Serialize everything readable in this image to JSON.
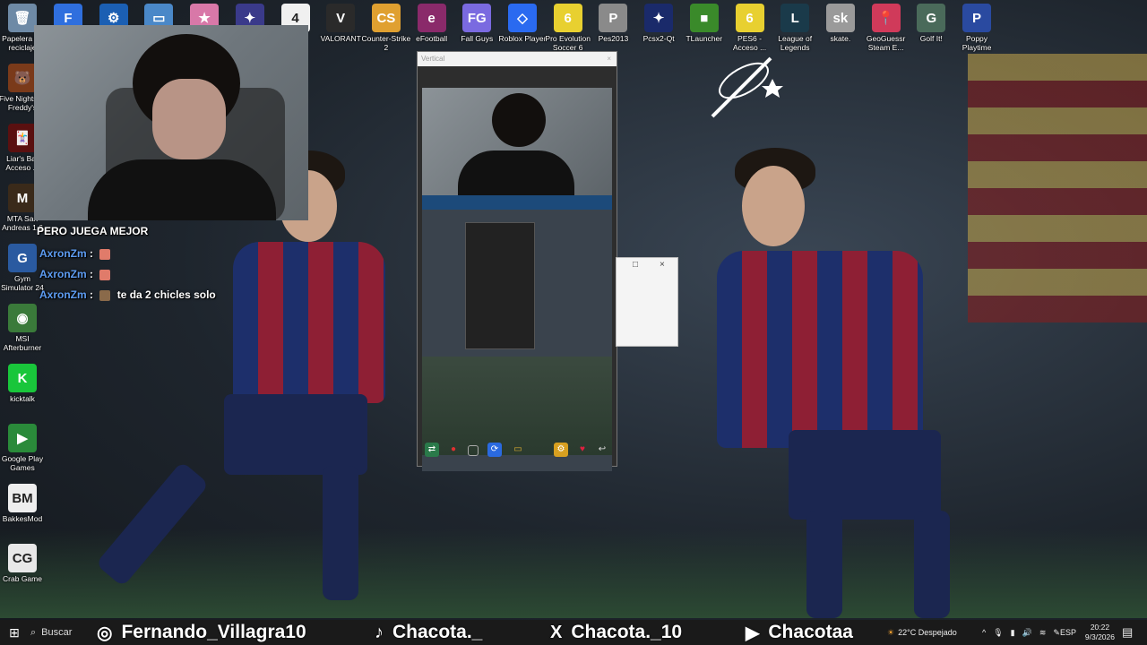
{
  "desktop_icons": [
    {
      "label": "Papelera de reciclaje",
      "icon": "recycle-bin-icon",
      "color": "#6e8aa6",
      "glyph": "🗑"
    },
    {
      "label": "Five Nights at Freddy's",
      "icon": "fnaf-icon",
      "color": "#7a3a1a",
      "glyph": "🐻"
    },
    {
      "label": "Liar's Bar Acceso ...",
      "icon": "liars-bar-icon",
      "color": "#5a1010",
      "glyph": "🃏"
    },
    {
      "label": "MTA San Andreas 1.6",
      "icon": "mta-icon",
      "color": "#3a2a1a",
      "glyph": "M"
    },
    {
      "label": "Gym Simulator 24",
      "icon": "gym-simulator-icon",
      "color": "#2a5aa0",
      "glyph": "G"
    },
    {
      "label": "MSI Afterburner",
      "icon": "msi-afterburner-icon",
      "color": "#3a7a3a",
      "glyph": "◉"
    },
    {
      "label": "kicktalk",
      "icon": "kicktalk-icon",
      "color": "#19c63b",
      "glyph": "K"
    },
    {
      "label": "Google Play Games",
      "icon": "google-play-games-icon",
      "color": "#2a8a3a",
      "glyph": "▶"
    },
    {
      "label": "BakkesMod",
      "icon": "bakkesmod-icon",
      "color": "#eeeeee",
      "glyph": "BM"
    },
    {
      "label": "Crab Game",
      "icon": "crab-game-icon",
      "color": "#e8e8e8",
      "glyph": "CG"
    }
  ],
  "top_icons": [
    {
      "label": "",
      "icon": "facebook-icon",
      "color": "#2f6fde",
      "glyph": "F"
    },
    {
      "label": "",
      "icon": "rocket-league-icon",
      "color": "#1b5fb3",
      "glyph": "⚙"
    },
    {
      "label": "",
      "icon": "app-window-icon",
      "color": "#4a88c8",
      "glyph": "▭"
    },
    {
      "label": "",
      "icon": "game-icon-pink",
      "color": "#d878a8",
      "glyph": "★"
    },
    {
      "label": "",
      "icon": "fortnite-icon",
      "color": "#3a3a8a",
      "glyph": "✦"
    },
    {
      "label": "",
      "icon": "resident-evil-icon",
      "color": "#f0f0f0",
      "glyph": "4"
    },
    {
      "label": "VALORANT",
      "icon": "valorant-icon",
      "color": "#2a2a2a",
      "glyph": "V"
    },
    {
      "label": "Counter-Strike 2",
      "icon": "counter-strike-icon",
      "color": "#e0a030",
      "glyph": "CS"
    },
    {
      "label": "eFootball",
      "icon": "efootball-icon",
      "color": "#8a2a6a",
      "glyph": "e"
    },
    {
      "label": "Fall Guys",
      "icon": "fall-guys-icon",
      "color": "#7a6ae0",
      "glyph": "FG"
    },
    {
      "label": "Roblox Player",
      "icon": "roblox-icon",
      "color": "#2a6af0",
      "glyph": "◇"
    },
    {
      "label": "Pro Evolution Soccer 6",
      "icon": "pes6-icon",
      "color": "#e8d030",
      "glyph": "6"
    },
    {
      "label": "Pes2013",
      "icon": "pes2013-icon",
      "color": "#8a8a8a",
      "glyph": "P"
    },
    {
      "label": "Pcsx2-Qt",
      "icon": "pcsx2-icon",
      "color": "#1a2a6a",
      "glyph": "✦"
    },
    {
      "label": "TLauncher",
      "icon": "tlauncher-icon",
      "color": "#3a8a2a",
      "glyph": "■"
    },
    {
      "label": "PES6 - Acceso ...",
      "icon": "pes6-shortcut-icon",
      "color": "#e8d030",
      "glyph": "6"
    },
    {
      "label": "League of Legends",
      "icon": "league-of-legends-icon",
      "color": "#1a3a4a",
      "glyph": "L"
    },
    {
      "label": "skate.",
      "icon": "skate-icon",
      "color": "#9a9a9a",
      "glyph": "sk"
    },
    {
      "label": "GeoGuessr Steam E...",
      "icon": "geoguessr-icon",
      "color": "#d03a5a",
      "glyph": "📍"
    },
    {
      "label": "Golf It!",
      "icon": "golf-it-icon",
      "color": "#4a6a5a",
      "glyph": "G"
    },
    {
      "label": "Poppy Playtime",
      "icon": "poppy-playtime-icon",
      "color": "#2a4aa0",
      "glyph": "P"
    }
  ],
  "chat": {
    "caption": "PERO JUEGA MEJOR",
    "lines": [
      {
        "user": "AxronZm",
        "sep": ":",
        "text": ""
      },
      {
        "user": "AxronZm",
        "sep": ":",
        "text": ""
      },
      {
        "user": "AxronZm",
        "sep": ":",
        "text": "te da 2 chicles solo"
      }
    ]
  },
  "vertical_window": {
    "title": "Vertical",
    "close": "×"
  },
  "dialog": {
    "maximize": "□",
    "close": "×"
  },
  "taskbar": {
    "search_label": "Buscar",
    "socials": [
      {
        "icon": "instagram-icon",
        "glyph": "◎",
        "handle": "Fernando_Villagra10"
      },
      {
        "icon": "tiktok-icon",
        "glyph": "♪",
        "handle": "Chacota._"
      },
      {
        "icon": "x-twitter-icon",
        "glyph": "X",
        "handle": "Chacota._10"
      },
      {
        "icon": "youtube-icon",
        "glyph": "▶",
        "handle": "Chacotaa"
      }
    ],
    "weather": "22°C Despejado",
    "language": "ESP",
    "time": "20:22",
    "date": "9/3/2026"
  }
}
